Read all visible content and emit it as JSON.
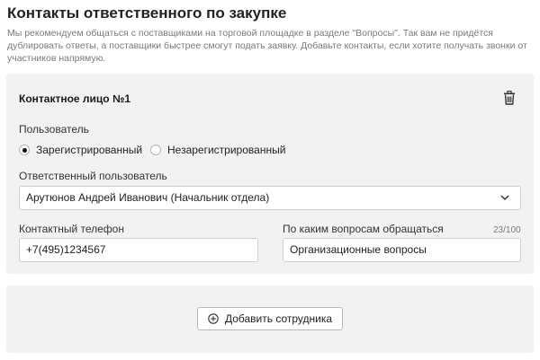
{
  "page": {
    "title": "Контакты ответственного по закупке",
    "description": "Мы рекомендуем общаться с поставщиками на торговой площадке в разделе \"Вопросы\". Так вам не придётся дублировать ответы, а поставщики быстрее смогут подать заявку. Добавьте контакты, если хотите получать звонки от участников напрямую."
  },
  "contact_card": {
    "title": "Контактное лицо №1",
    "delete_icon": "trash-icon",
    "user_label": "Пользователь",
    "radio_options": [
      {
        "label": "Зарегистрированный",
        "selected": true
      },
      {
        "label": "Незарегистрированный",
        "selected": false
      }
    ],
    "responsible_label": "Ответственный пользователь",
    "responsible_value": "Арутюнов Андрей Иванович (Начальник отдела)",
    "phone_label": "Контактный телефон",
    "phone_value": "+7(495)1234567",
    "topics_label": "По каким вопросам обращаться",
    "topics_counter": "23/100",
    "topics_value": "Организационные вопросы"
  },
  "add_card": {
    "add_button_label": "Добавить сотрудника",
    "add_icon": "plus-circle-icon"
  }
}
